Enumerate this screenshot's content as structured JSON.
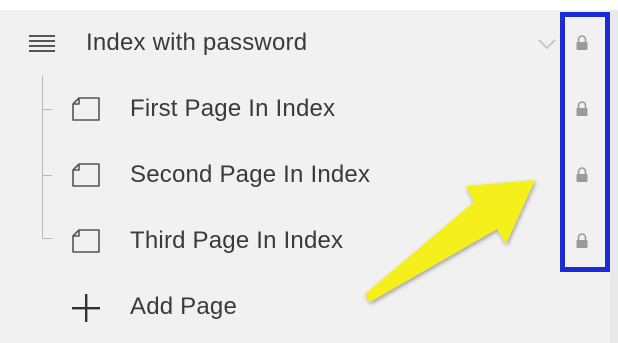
{
  "index": {
    "title": "Index with password",
    "icon": "hamburger-menu-icon",
    "expand_icon": "chevron-down-icon"
  },
  "pages": [
    {
      "label": "First Page In Index",
      "icon": "page-icon",
      "lock_icon": "lock-icon"
    },
    {
      "label": "Second Page In Index",
      "icon": "page-icon",
      "lock_icon": "lock-icon"
    },
    {
      "label": "Third Page In Index",
      "icon": "page-icon",
      "lock_icon": "lock-icon"
    }
  ],
  "add_page": {
    "label": "Add Page",
    "icon": "plus-icon"
  },
  "annotation": {
    "highlight_color": "#1b2bd6",
    "arrow_color": "#f5f01e"
  }
}
